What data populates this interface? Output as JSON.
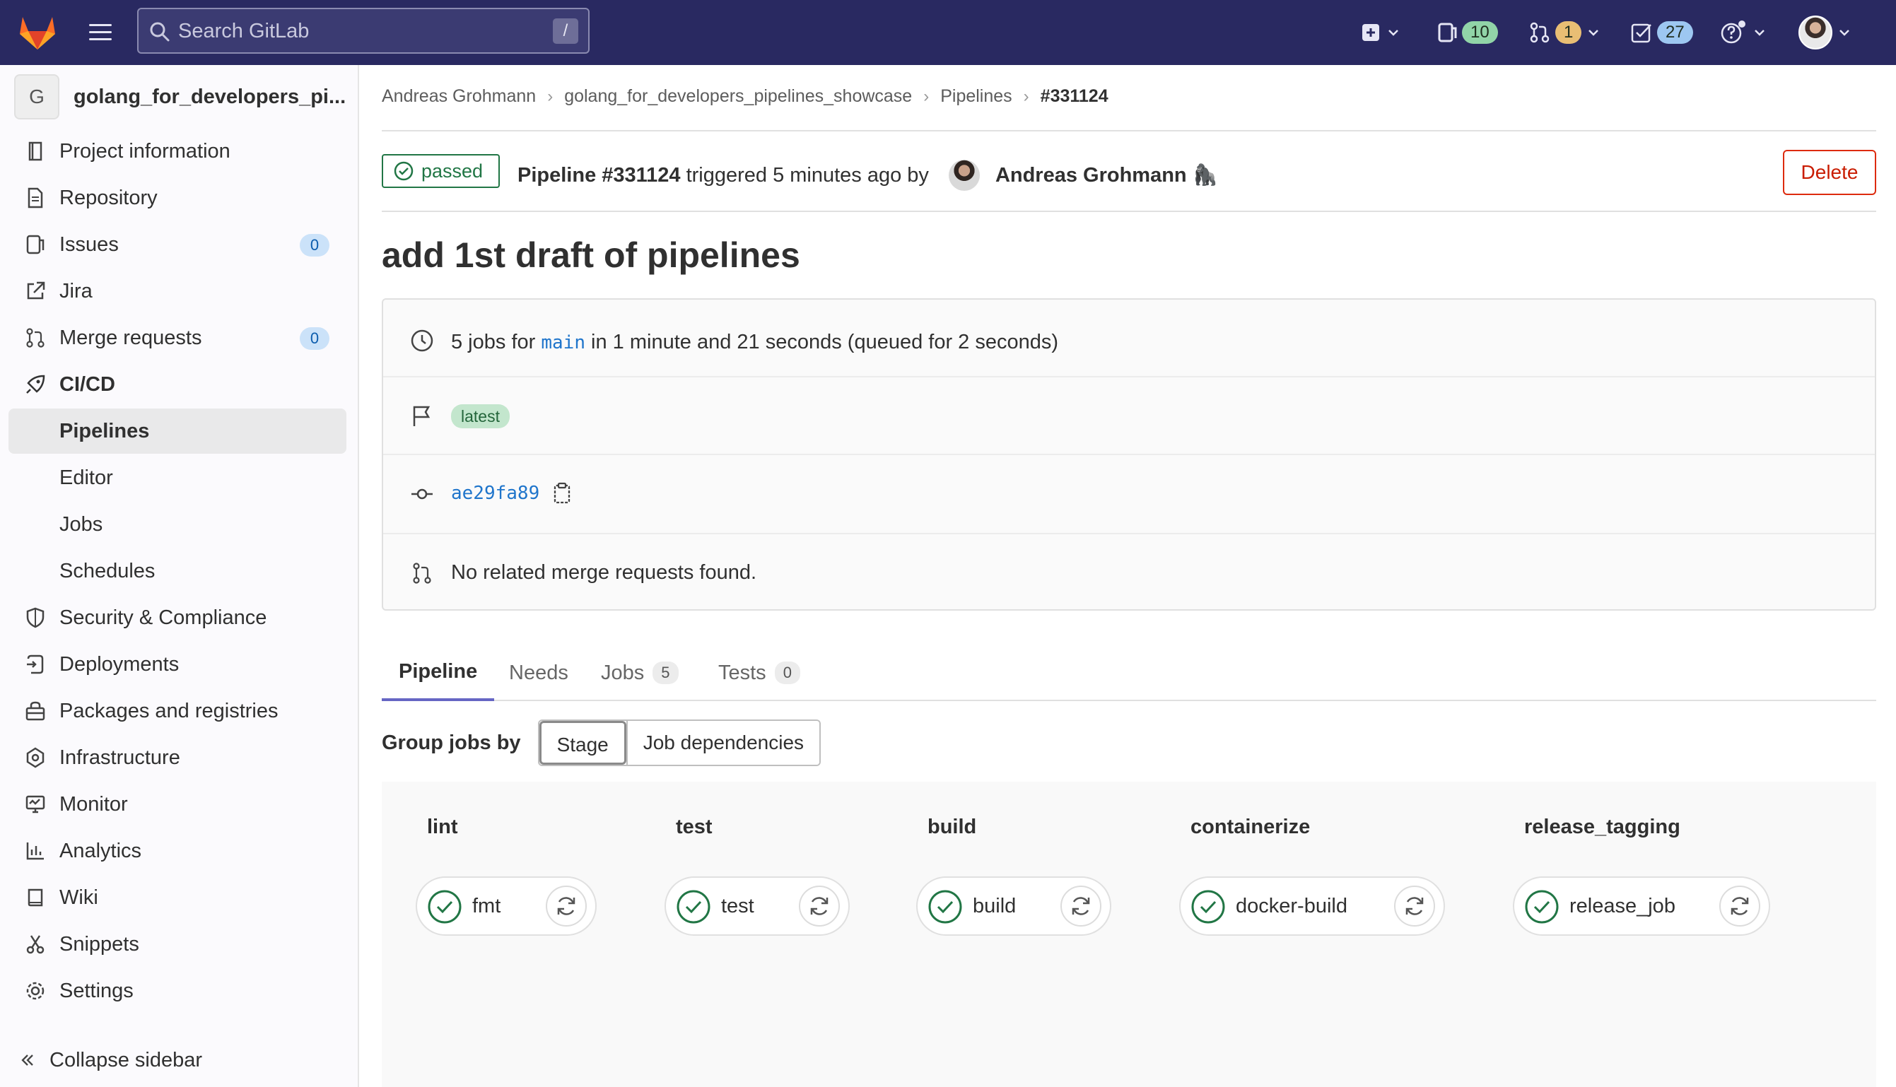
{
  "topbar": {
    "search_placeholder": "Search GitLab",
    "search_shortcut": "/",
    "issues_count": "10",
    "merge_requests_count": "1",
    "todos_count": "27"
  },
  "sidebar": {
    "project_initial": "G",
    "project_name": "golang_for_developers_pi...",
    "items": [
      {
        "label": "Project information"
      },
      {
        "label": "Repository"
      },
      {
        "label": "Issues",
        "count": "0"
      },
      {
        "label": "Jira"
      },
      {
        "label": "Merge requests",
        "count": "0"
      },
      {
        "label": "CI/CD"
      },
      {
        "label": "Pipelines"
      },
      {
        "label": "Editor"
      },
      {
        "label": "Jobs"
      },
      {
        "label": "Schedules"
      },
      {
        "label": "Security & Compliance"
      },
      {
        "label": "Deployments"
      },
      {
        "label": "Packages and registries"
      },
      {
        "label": "Infrastructure"
      },
      {
        "label": "Monitor"
      },
      {
        "label": "Analytics"
      },
      {
        "label": "Wiki"
      },
      {
        "label": "Snippets"
      },
      {
        "label": "Settings"
      }
    ],
    "collapse_label": "Collapse sidebar"
  },
  "breadcrumb": {
    "items": [
      "Andreas Grohmann",
      "golang_for_developers_pipelines_showcase",
      "Pipelines",
      "#331124"
    ]
  },
  "pipeline": {
    "status": "passed",
    "title_bold": "Pipeline #331124",
    "title_rest": "triggered 5 minutes ago by",
    "author": "Andreas Grohmann",
    "author_emoji": "🦍",
    "delete_label": "Delete",
    "commit_title": "add 1st draft of pipelines",
    "jobs_prefix": "5 jobs for",
    "branch": "main",
    "jobs_suffix": "in 1 minute and 21 seconds (queued for 2 seconds)",
    "tag": "latest",
    "commit_sha": "ae29fa89",
    "mr_text": "No related merge requests found."
  },
  "tabs": [
    {
      "label": "Pipeline"
    },
    {
      "label": "Needs"
    },
    {
      "label": "Jobs",
      "count": "5"
    },
    {
      "label": "Tests",
      "count": "0"
    }
  ],
  "group_by": {
    "label": "Group jobs by",
    "options": [
      "Stage",
      "Job dependencies"
    ],
    "selected": "Stage"
  },
  "stages": [
    {
      "name": "lint",
      "job": "fmt"
    },
    {
      "name": "test",
      "job": "test"
    },
    {
      "name": "build",
      "job": "build"
    },
    {
      "name": "containerize",
      "job": "docker-build"
    },
    {
      "name": "release_tagging",
      "job": "release_job"
    }
  ],
  "colors": {
    "topbar": "#292961",
    "success": "#217645",
    "link": "#1f75cb",
    "danger": "#dd2b0e"
  }
}
